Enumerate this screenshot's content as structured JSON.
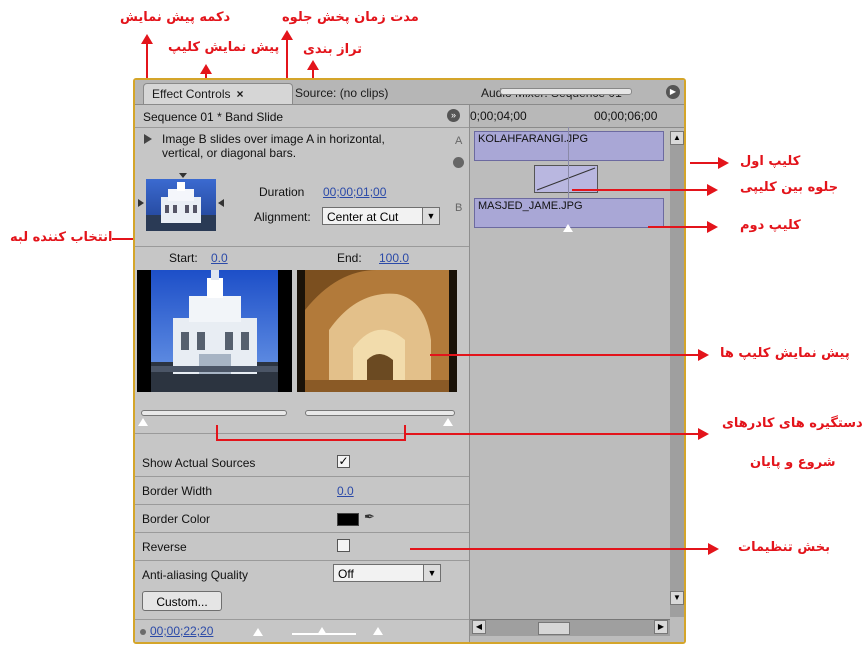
{
  "annotations": {
    "preview_button": "دکمه پیش نمایش",
    "transition_duration": "مدت زمان پخش جلوه",
    "clip_preview": "پیش نمایش کلیپ",
    "alignment": "تراز بندی",
    "edge_selector": "انتخاب کننده لبه",
    "first_clip": "کلیپ اول",
    "transition_between_clips": "جلوه بین کلیپی",
    "second_clip": "کلیپ دوم",
    "clips_preview": "پیش نمایش کلیپ ها",
    "frame_handles_line1": "دستگیره های کادرهای",
    "frame_handles_line2": "شروع و پایان",
    "settings_section": "بخش تنظیمات",
    "colors": {
      "annotation": "#e3141b"
    }
  },
  "tabs": {
    "effect_controls": "Effect Controls",
    "close_glyph": "×",
    "source": "Source: (no clips)",
    "audio_mixer": "Audio Mixer: Sequence 01",
    "menu_icon": "play-circle-icon"
  },
  "header": {
    "sequence_title": "Sequence 01 * Band Slide",
    "expand_icon": "»"
  },
  "timeline": {
    "time_left": "0;00;04;00",
    "time_right": "00;00;06;00",
    "track_a_letter": "A",
    "track_b_letter": "B",
    "clip_a": "KOLAHFARANGI.JPG",
    "clip_b": "MASJED_JAME.JPG"
  },
  "transition": {
    "description": "Image B slides over image A in horizontal, vertical, or diagonal bars.",
    "duration_label": "Duration",
    "duration_value": "00;00;01;00",
    "alignment_label": "Alignment:",
    "alignment_value": "Center at Cut",
    "dropdown_glyph": "▼"
  },
  "preview": {
    "start_label": "Start:",
    "start_value": "0.0",
    "end_label": "End:",
    "end_value": "100.0"
  },
  "settings": {
    "show_actual_sources_label": "Show Actual Sources",
    "show_actual_sources_checked": "✓",
    "border_width_label": "Border Width",
    "border_width_value": "0.0",
    "border_color_label": "Border Color",
    "border_color": "#000000",
    "reverse_label": "Reverse",
    "anti_aliasing_label": "Anti-aliasing Quality",
    "anti_aliasing_value": "Off",
    "custom_button": "Custom..."
  },
  "footer": {
    "timecode": "00;00;22;20"
  }
}
